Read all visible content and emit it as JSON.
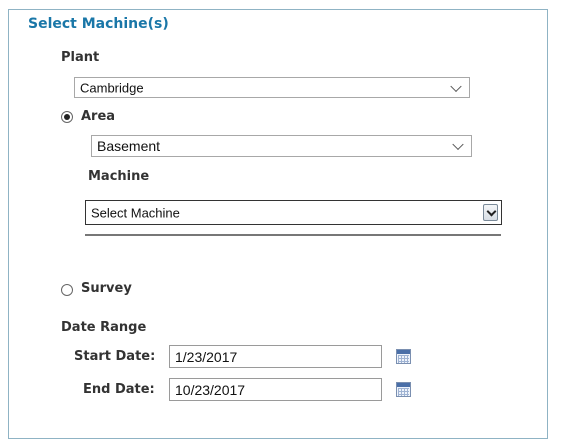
{
  "section_title": "Select Machine(s)",
  "plant": {
    "label": "Plant",
    "selected": "Cambridge"
  },
  "area": {
    "label": "Area",
    "selected": "Basement",
    "checked": true
  },
  "machine": {
    "label": "Machine",
    "selected": "Select Machine"
  },
  "survey": {
    "label": "Survey",
    "checked": false
  },
  "date_range": {
    "label": "Date Range",
    "start_label": "Start Date:",
    "start_value": "1/23/2017",
    "end_label": "End Date:",
    "end_value": "10/23/2017"
  },
  "icons": {
    "calendar": "calendar-icon",
    "dropdown": "chevron-down-icon",
    "radio_on": "radio-checked-icon",
    "radio_off": "radio-unchecked-icon"
  },
  "colors": {
    "title": "#1a77a8",
    "panel_border": "#8fb3c4"
  }
}
